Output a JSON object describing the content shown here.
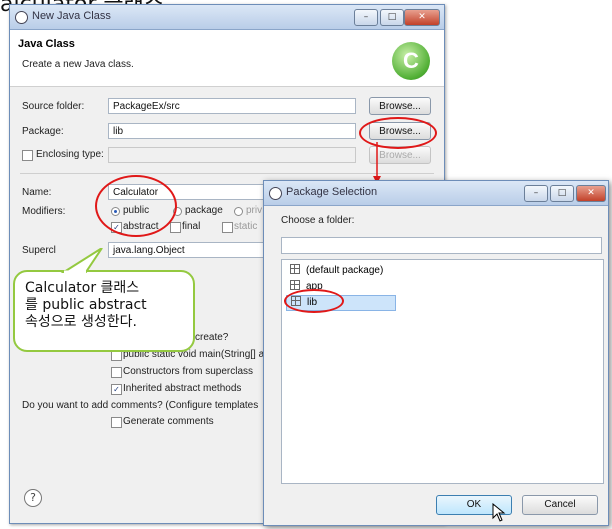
{
  "caption_fragment": "alculator 클래스",
  "main_window": {
    "title": "New Java Class",
    "header_title": "Java Class",
    "header_subtitle": "Create a new Java class.",
    "logo_letter": "C",
    "source_folder_label": "Source folder:",
    "source_folder_value": "PackageEx/src",
    "package_label": "Package:",
    "package_value": "lib",
    "enclosing_label": "Enclosing type:",
    "browse_label": "Browse...",
    "name_label": "Name:",
    "name_value": "Calculator",
    "modifiers_label": "Modifiers:",
    "mod_public": "public",
    "mod_package": "package",
    "mod_private": "priv",
    "mod_abstract": "abstract",
    "mod_final": "final",
    "mod_static": "static",
    "superclass_label": "Supercl",
    "superclass_value": "java.lang.Object",
    "stubs_question_tail": "create?",
    "stub_main": "public static void main(String[] a",
    "stub_constructors": "Constructors from superclass",
    "stub_inherited": "Inherited abstract methods",
    "comments_question": "Do you want to add comments? (Configure templates",
    "generate_comments": "Generate comments",
    "help_icon_text": "?"
  },
  "dialog": {
    "title": "Package Selection",
    "prompt": "Choose a folder:",
    "filter_value": "",
    "items": [
      "(default package)",
      "app",
      "lib"
    ],
    "ok_label": "OK",
    "cancel_label": "Cancel"
  },
  "callout": {
    "lines": [
      "Calculator 클래스",
      "를 public abstract",
      "속성으로 생성한다."
    ]
  },
  "colors": {
    "annotation_red": "#e01818",
    "callout_border": "#94c940",
    "selection": "#cde4fa"
  }
}
